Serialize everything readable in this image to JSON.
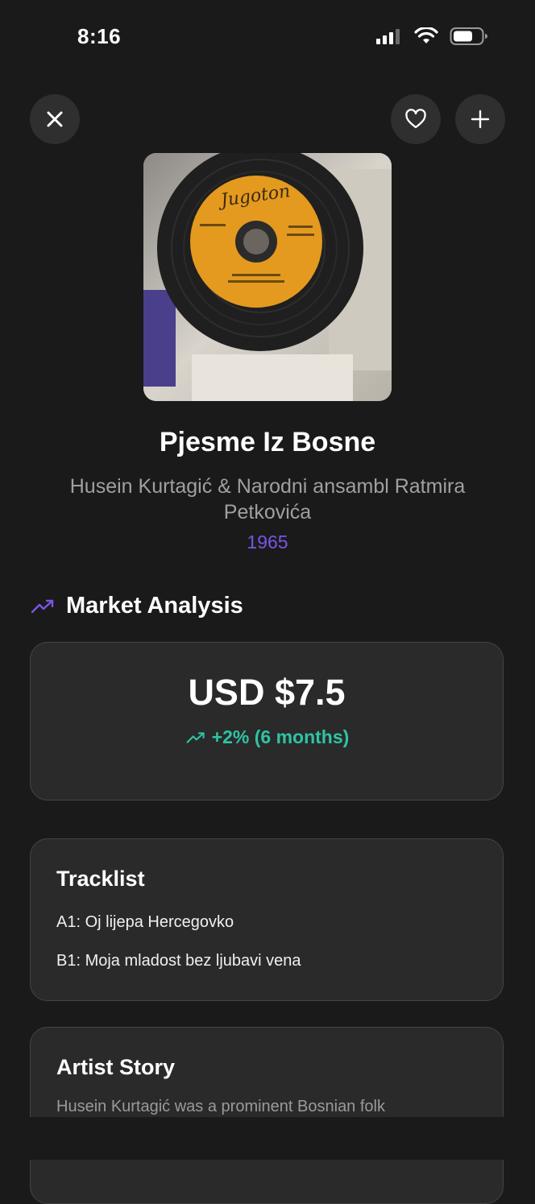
{
  "status": {
    "time": "8:16"
  },
  "album": {
    "title": "Pjesme Iz Bosne",
    "artist": "Husein Kurtagić & Narodni ansambl Ratmira Petkovića",
    "year": "1965",
    "label_text": "Jugoton"
  },
  "market": {
    "heading": "Market Analysis",
    "price": "USD $7.5",
    "change": "+2% (6 months)"
  },
  "tracklist": {
    "heading": "Tracklist",
    "tracks": [
      "A1: Oj lijepa Hercegovko",
      "B1: Moja mladost bez ljubavi vena"
    ]
  },
  "story": {
    "heading": "Artist Story",
    "text": "Husein Kurtagić was a prominent Bosnian folk"
  },
  "colors": {
    "accent": "#7b54e8",
    "positive": "#2ec4a4",
    "background": "#1a1a1a",
    "card": "#2a2a2a"
  },
  "icons": [
    "close-icon",
    "heart-icon",
    "plus-icon",
    "trending-up-icon",
    "signal-icon",
    "wifi-icon",
    "battery-icon"
  ]
}
